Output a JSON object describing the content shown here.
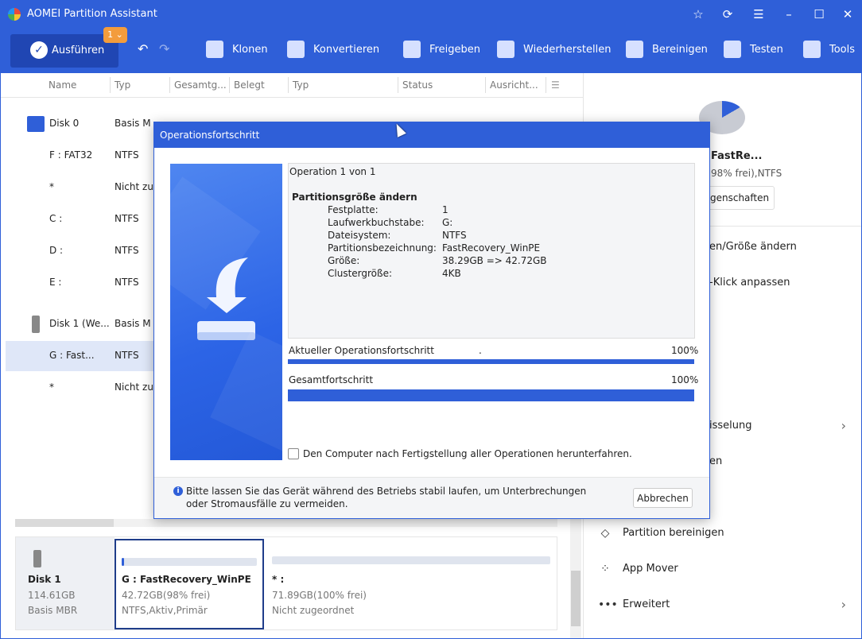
{
  "window": {
    "title": "AOMEI Partition Assistant"
  },
  "toolbar": {
    "run_label": "Ausführen",
    "pending_count": "1",
    "items": [
      "Klonen",
      "Konvertieren",
      "Freigeben",
      "Wiederherstellen",
      "Bereinigen",
      "Testen",
      "Tools"
    ]
  },
  "columns": [
    "Name",
    "Typ",
    "Gesamtg...",
    "Belegt",
    "Typ",
    "Status",
    "Ausricht..."
  ],
  "rows": [
    {
      "name": "Disk 0",
      "type": "Basis M"
    },
    {
      "name": "F : FAT32",
      "type": "NTFS"
    },
    {
      "name": "*",
      "type": "Nicht zu"
    },
    {
      "name": "C :",
      "type": "NTFS"
    },
    {
      "name": "D :",
      "type": "NTFS"
    },
    {
      "name": "E :",
      "type": "NTFS"
    },
    {
      "name": "Disk 1 (We...",
      "type": "Basis M"
    },
    {
      "name": "G : Fast...",
      "type": "NTFS"
    },
    {
      "name": "*",
      "type": "Nicht zu"
    }
  ],
  "right_panel": {
    "part_name": "FastRe...",
    "part_info": "98% frei),NTFS",
    "properties_label": "genschaften",
    "items": [
      {
        "label": "en/Größe ändern"
      },
      {
        "label": "-Klick anpassen"
      },
      {
        "label": "isselung"
      },
      {
        "label": "en"
      },
      {
        "label": "Partition bereinigen"
      },
      {
        "label": "App Mover"
      },
      {
        "label": "Erweitert"
      }
    ]
  },
  "diskmap": {
    "disk": {
      "name": "Disk 1",
      "size": "114.61GB",
      "type": "Basis MBR"
    },
    "partitions": [
      {
        "name": "G : FastRecovery_WinPE",
        "size": "42.72GB(98% frei)",
        "info": "NTFS,Aktiv,Primär",
        "used_fraction": 0.02
      },
      {
        "name": "* :",
        "size": "71.89GB(100% frei)",
        "info": "Nicht zugeordnet",
        "used_fraction": 0
      }
    ]
  },
  "dialog": {
    "title": "Operationsfortschritt",
    "operation_count": "Operation 1 von 1",
    "operation_name": "Partitionsgröße ändern",
    "details": [
      {
        "key": "Festplatte:",
        "value": "1"
      },
      {
        "key": "Laufwerkbuchstabe:",
        "value": "G:"
      },
      {
        "key": "Dateisystem:",
        "value": "NTFS"
      },
      {
        "key": "Partitionsbezeichnung:",
        "value": "FastRecovery_WinPE"
      },
      {
        "key": "Größe:",
        "value": "38.29GB => 42.72GB"
      },
      {
        "key": "Clustergröße:",
        "value": "4KB"
      }
    ],
    "current_label": "Aktueller Operationsfortschritt",
    "current_dot": ".",
    "current_percent": "100%",
    "current_value": 1.0,
    "total_label": "Gesamtfortschritt",
    "total_percent": "100%",
    "total_value": 1.0,
    "shutdown_label": "Den Computer nach Fertigstellung aller Operationen herunterfahren.",
    "info_line1": "Bitte lassen Sie das Gerät während des Betriebs stabil laufen, um Unterbrechungen",
    "info_line2": "oder Stromausfälle zu vermeiden.",
    "cancel_label": "Abbrechen"
  }
}
